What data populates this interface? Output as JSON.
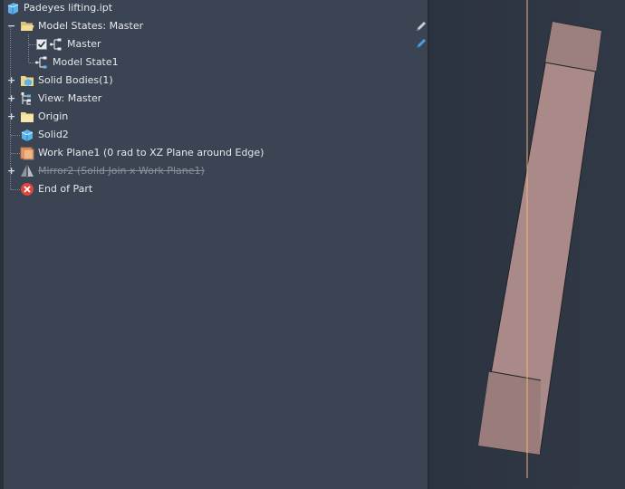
{
  "browser": {
    "root": {
      "label": "Padeyes lifting.ipt",
      "icon": "part-file-icon"
    },
    "model_states": {
      "label": "Model States: Master",
      "expanded": true,
      "children": [
        {
          "label": "Master",
          "checked": true,
          "icon": "model-state-icon"
        },
        {
          "label": "Model State1",
          "icon": "model-state-icon"
        }
      ]
    },
    "items": [
      {
        "label": "Solid Bodies(1)",
        "icon": "solid-bodies-folder-icon",
        "expandable": true
      },
      {
        "label": "View: Master",
        "icon": "view-rep-icon",
        "expandable": true
      },
      {
        "label": "Origin",
        "icon": "folder-icon",
        "expandable": true
      },
      {
        "label": "Solid2",
        "icon": "solid-body-icon",
        "expandable": false
      },
      {
        "label": "Work Plane1 (0 rad to XZ Plane around Edge)",
        "icon": "work-plane-icon",
        "expandable": false
      },
      {
        "label": "Mirror2 (Solid Join x Work Plane1)",
        "icon": "mirror-feature-icon",
        "expandable": true,
        "suppressed": true
      },
      {
        "label": "End of Part",
        "icon": "end-of-part-icon",
        "expandable": false
      }
    ]
  },
  "colors": {
    "panel_bg": "#3b4453",
    "viewport_bg": "#2f3644",
    "part_face": "#a98a88",
    "axis_line": "#f2b27a",
    "edit_pencil_active": "#4aa0e0"
  }
}
